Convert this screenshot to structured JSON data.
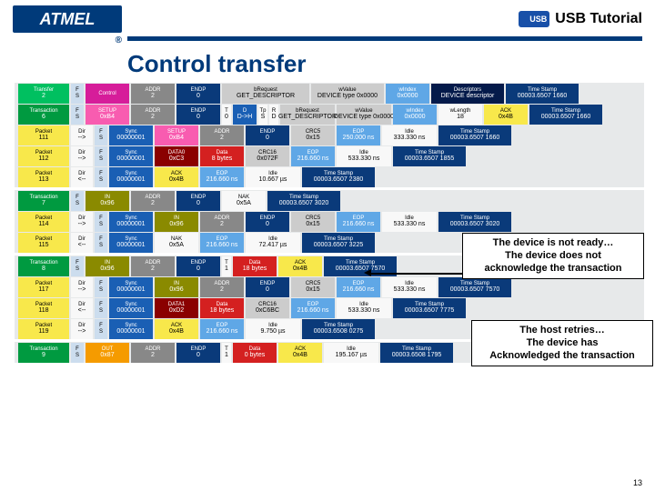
{
  "header": {
    "logo": "ATMEL",
    "usb_badge": "USB",
    "title": "USB Tutorial"
  },
  "slide_title": "Control transfer",
  "page_number": "13",
  "callouts": {
    "not_ready": {
      "line1": "The device is not ready…",
      "line2": "The device does not",
      "line3": "acknowledge the transaction"
    },
    "retries": {
      "line1": "The host retries…",
      "line2": "The device has",
      "line3": "Acknowledged the transaction"
    }
  },
  "rows": [
    {
      "type": "transfer",
      "tag": "Transfer",
      "tagnum": "2",
      "fs": [
        "F",
        "S"
      ],
      "cells": [
        {
          "c": "c-magenta",
          "h": "Control",
          "v": ""
        },
        {
          "c": "c-gray",
          "h": "ADDR",
          "v": "2"
        },
        {
          "c": "c-dkblue",
          "h": "ENDP",
          "v": "0"
        },
        {
          "c": "c-ltgray w-ll",
          "h": "bRequest",
          "v": "GET_DESCRIPTOR"
        },
        {
          "c": "c-ltgray w-l",
          "h": "wValue",
          "v": "DEVICE type 0x0000"
        },
        {
          "c": "c-skyblue",
          "h": "wIndex",
          "v": "0x0000"
        },
        {
          "c": "c-darkblue w-l",
          "h": "Descriptors",
          "v": "DEVICE descriptor"
        },
        {
          "c": "c-dkblue w-l",
          "h": "Time Stamp",
          "v": "00003.6507 1660"
        }
      ]
    },
    {
      "type": "transaction",
      "tag": "Transaction",
      "tagnum": "6",
      "fs": [
        "F",
        "S"
      ],
      "cells": [
        {
          "c": "c-pink",
          "h": "SETUP",
          "v": "0xB4"
        },
        {
          "c": "c-gray",
          "h": "ADDR",
          "v": "2"
        },
        {
          "c": "c-dkblue",
          "h": "ENDP",
          "v": "0"
        },
        {
          "c": "c-white w-xs",
          "h": "T",
          "v": "0"
        },
        {
          "c": "c-blue w-s",
          "h": "D",
          "v": "D->H"
        },
        {
          "c": "c-white w-xs",
          "h": "Tp",
          "v": "S"
        },
        {
          "c": "c-white w-xs",
          "h": "R",
          "v": "D"
        },
        {
          "c": "c-ltgray w-mm",
          "h": "bRequest",
          "v": "GET_DESCRIPTOR"
        },
        {
          "c": "c-ltgray w-mm",
          "h": "wValue",
          "v": "DEVICE type 0x0000"
        },
        {
          "c": "c-skyblue",
          "h": "wIndex",
          "v": "0x0000"
        },
        {
          "c": "c-white",
          "h": "wLength",
          "v": "18"
        },
        {
          "c": "c-yellow",
          "h": "ACK",
          "v": "0x4B"
        },
        {
          "c": "c-dkblue w-l",
          "h": "Time Stamp",
          "v": "00003.6507 1660"
        }
      ]
    },
    {
      "type": "packet",
      "tag": "Packet",
      "tagnum": "111",
      "dir": "-->",
      "cells": [
        {
          "c": "c-blue w-m",
          "h": "Sync",
          "v": "00000001"
        },
        {
          "c": "c-pink w-m",
          "h": "SETUP",
          "v": "0xB4"
        },
        {
          "c": "c-gray",
          "h": "ADDR",
          "v": "2"
        },
        {
          "c": "c-dkblue",
          "h": "ENDP",
          "v": "0"
        },
        {
          "c": "c-ltgray",
          "h": "CRC5",
          "v": "0x15"
        },
        {
          "c": "c-skyblue w-m",
          "h": "EOP",
          "v": "250.000 ns"
        },
        {
          "c": "c-white w-mm",
          "h": "Idle",
          "v": "333.330 ns"
        },
        {
          "c": "c-dkblue w-l",
          "h": "Time Stamp",
          "v": "00003.6507 1660"
        }
      ]
    },
    {
      "type": "packet",
      "tag": "Packet",
      "tagnum": "112",
      "dir": "-->",
      "cells": [
        {
          "c": "c-blue w-m",
          "h": "Sync",
          "v": "00000001"
        },
        {
          "c": "c-darkred w-m",
          "h": "DATA0",
          "v": "0xC3"
        },
        {
          "c": "c-red w-m",
          "h": "Data",
          "v": "8 bytes"
        },
        {
          "c": "c-ltgray",
          "h": "CRC16",
          "v": "0x072F"
        },
        {
          "c": "c-skyblue w-m",
          "h": "EOP",
          "v": "216.660 ns"
        },
        {
          "c": "c-white w-mm",
          "h": "Idle",
          "v": "533.330 ns"
        },
        {
          "c": "c-dkblue w-l",
          "h": "Time Stamp",
          "v": "00003.6507 1855"
        }
      ]
    },
    {
      "type": "packet",
      "tag": "Packet",
      "tagnum": "113",
      "dir": "<--",
      "cells": [
        {
          "c": "c-blue w-m",
          "h": "Sync",
          "v": "00000001"
        },
        {
          "c": "c-yellow w-m",
          "h": "ACK",
          "v": "0x4B"
        },
        {
          "c": "c-skyblue w-m",
          "h": "EOP",
          "v": "216.660 ns"
        },
        {
          "c": "c-white w-mm",
          "h": "Idle",
          "v": "10.667 µs"
        },
        {
          "c": "c-dkblue w-l",
          "h": "Time Stamp",
          "v": "00003.6507 2380"
        }
      ]
    },
    {
      "type": "transaction",
      "tag": "Transaction",
      "tagnum": "7",
      "fs": [
        "F",
        "S"
      ],
      "cells": [
        {
          "c": "c-olive w-m",
          "h": "IN",
          "v": "0x96"
        },
        {
          "c": "c-gray",
          "h": "ADDR",
          "v": "2"
        },
        {
          "c": "c-dkblue",
          "h": "ENDP",
          "v": "0"
        },
        {
          "c": "c-white w-m",
          "h": "NAK",
          "v": "0x5A"
        },
        {
          "c": "c-dkblue w-l",
          "h": "Time Stamp",
          "v": "00003.6507 3020"
        }
      ]
    },
    {
      "type": "packet",
      "tag": "Packet",
      "tagnum": "114",
      "dir": "-->",
      "cells": [
        {
          "c": "c-blue w-m",
          "h": "Sync",
          "v": "00000001"
        },
        {
          "c": "c-olive w-m",
          "h": "IN",
          "v": "0x96"
        },
        {
          "c": "c-gray",
          "h": "ADDR",
          "v": "2"
        },
        {
          "c": "c-dkblue",
          "h": "ENDP",
          "v": "0"
        },
        {
          "c": "c-ltgray",
          "h": "CRC5",
          "v": "0x15"
        },
        {
          "c": "c-skyblue w-m",
          "h": "EOP",
          "v": "216.660 ns"
        },
        {
          "c": "c-white w-mm",
          "h": "Idle",
          "v": "533.330 ns"
        },
        {
          "c": "c-dkblue w-l",
          "h": "Time Stamp",
          "v": "00003.6507 3020"
        }
      ]
    },
    {
      "type": "packet",
      "tag": "Packet",
      "tagnum": "115",
      "dir": "<--",
      "cells": [
        {
          "c": "c-blue w-m",
          "h": "Sync",
          "v": "00000001"
        },
        {
          "c": "c-white w-m",
          "h": "NAK",
          "v": "0x5A"
        },
        {
          "c": "c-skyblue w-m",
          "h": "EOP",
          "v": "216.660 ns"
        },
        {
          "c": "c-white w-mm",
          "h": "Idle",
          "v": "72.417 µs"
        },
        {
          "c": "c-dkblue w-l",
          "h": "Time Stamp",
          "v": "00003.6507 3225"
        }
      ]
    },
    {
      "type": "transaction",
      "tag": "Transaction",
      "tagnum": "8",
      "fs": [
        "F",
        "S"
      ],
      "cells": [
        {
          "c": "c-olive w-m",
          "h": "IN",
          "v": "0x96"
        },
        {
          "c": "c-gray",
          "h": "ADDR",
          "v": "2"
        },
        {
          "c": "c-dkblue",
          "h": "ENDP",
          "v": "0"
        },
        {
          "c": "c-white w-xs",
          "h": "T",
          "v": "1"
        },
        {
          "c": "c-red w-m",
          "h": "Data",
          "v": "18 bytes"
        },
        {
          "c": "c-yellow",
          "h": "ACK",
          "v": "0x4B"
        },
        {
          "c": "c-dkblue w-l",
          "h": "Time Stamp",
          "v": "00003.6507 7570"
        }
      ]
    },
    {
      "type": "packet",
      "tag": "Packet",
      "tagnum": "117",
      "dir": "-->",
      "cells": [
        {
          "c": "c-blue w-m",
          "h": "Sync",
          "v": "00000001"
        },
        {
          "c": "c-olive w-m",
          "h": "IN",
          "v": "0x96"
        },
        {
          "c": "c-gray",
          "h": "ADDR",
          "v": "2"
        },
        {
          "c": "c-dkblue",
          "h": "ENDP",
          "v": "0"
        },
        {
          "c": "c-ltgray",
          "h": "CRC5",
          "v": "0x15"
        },
        {
          "c": "c-skyblue w-m",
          "h": "EOP",
          "v": "216.660 ns"
        },
        {
          "c": "c-white w-mm",
          "h": "Idle",
          "v": "533.330 ns"
        },
        {
          "c": "c-dkblue w-l",
          "h": "Time Stamp",
          "v": "00003.6507 7570"
        }
      ]
    },
    {
      "type": "packet",
      "tag": "Packet",
      "tagnum": "118",
      "dir": "<--",
      "cells": [
        {
          "c": "c-blue w-m",
          "h": "Sync",
          "v": "00000001"
        },
        {
          "c": "c-darkred w-m",
          "h": "DATA1",
          "v": "0xD2"
        },
        {
          "c": "c-red w-m",
          "h": "Data",
          "v": "18 bytes"
        },
        {
          "c": "c-ltgray",
          "h": "CRC16",
          "v": "0xC6BC"
        },
        {
          "c": "c-skyblue w-m",
          "h": "EOP",
          "v": "216.660 ns"
        },
        {
          "c": "c-white w-mm",
          "h": "Idle",
          "v": "533.330 ns"
        },
        {
          "c": "c-dkblue w-l",
          "h": "Time Stamp",
          "v": "00003.6507 7775"
        }
      ]
    },
    {
      "type": "packet",
      "tag": "Packet",
      "tagnum": "119",
      "dir": "-->",
      "cells": [
        {
          "c": "c-blue w-m",
          "h": "Sync",
          "v": "00000001"
        },
        {
          "c": "c-yellow w-m",
          "h": "ACK",
          "v": "0x4B"
        },
        {
          "c": "c-skyblue w-m",
          "h": "EOP",
          "v": "216.660 ns"
        },
        {
          "c": "c-white w-mm",
          "h": "Idle",
          "v": "9.750 µs"
        },
        {
          "c": "c-dkblue w-l",
          "h": "Time Stamp",
          "v": "00003.6508 0275"
        }
      ]
    },
    {
      "type": "transaction",
      "tag": "Transaction",
      "tagnum": "9",
      "fs": [
        "F",
        "S"
      ],
      "cells": [
        {
          "c": "c-orange w-m",
          "h": "OUT",
          "v": "0x87"
        },
        {
          "c": "c-gray",
          "h": "ADDR",
          "v": "2"
        },
        {
          "c": "c-dkblue",
          "h": "ENDP",
          "v": "0"
        },
        {
          "c": "c-white w-xs",
          "h": "T",
          "v": "1"
        },
        {
          "c": "c-red w-m",
          "h": "Data",
          "v": "0 bytes"
        },
        {
          "c": "c-yellow",
          "h": "ACK",
          "v": "0x4B"
        },
        {
          "c": "c-white w-mm",
          "h": "Idle",
          "v": "195.167 µs"
        },
        {
          "c": "c-dkblue w-l",
          "h": "Time Stamp",
          "v": "00003.6508 1795"
        }
      ]
    }
  ]
}
